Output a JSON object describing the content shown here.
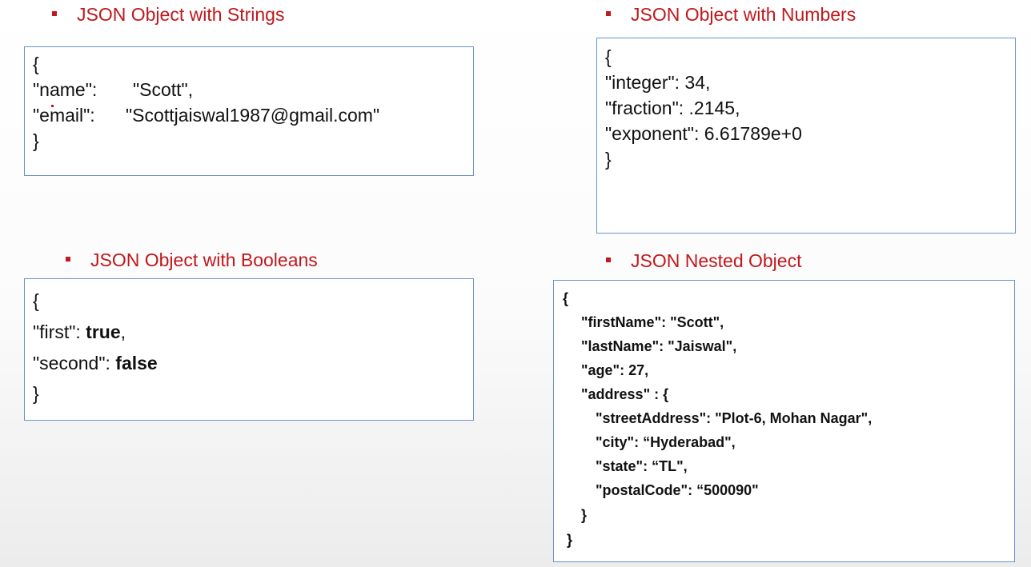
{
  "strings": {
    "heading": "JSON Object with Strings",
    "lines": [
      "{",
      "\"name\":       \"Scott\",",
      "\"email\":      \"Scottjaiswal1987@gmail.com\"",
      "}"
    ]
  },
  "numbers": {
    "heading": "JSON Object with Numbers",
    "lines": [
      "{",
      "\"integer\": 34,",
      "\"fraction\": .2145,",
      "\"exponent\": 6.61789e+0",
      "}"
    ]
  },
  "booleans": {
    "heading": "JSON Object with Booleans",
    "open": "{",
    "first_key": "\"first\": ",
    "first_val": "true",
    "first_tail": ",",
    "second_key": "\"second\": ",
    "second_val": "false",
    "close": "}"
  },
  "nested": {
    "heading": "JSON Nested Object",
    "lines": [
      "{",
      "\"firstName\": \"Scott\",",
      "\"lastName\": \"Jaiswal\",",
      "\"age\": 27,",
      "\"address\" : {",
      "\"streetAddress\": \"Plot-6, Mohan Nagar\",",
      "\"city\": “Hyderabad\",",
      "\"state\": “TL\",",
      "\"postalCode\": “500090\"",
      "}",
      "}"
    ]
  }
}
